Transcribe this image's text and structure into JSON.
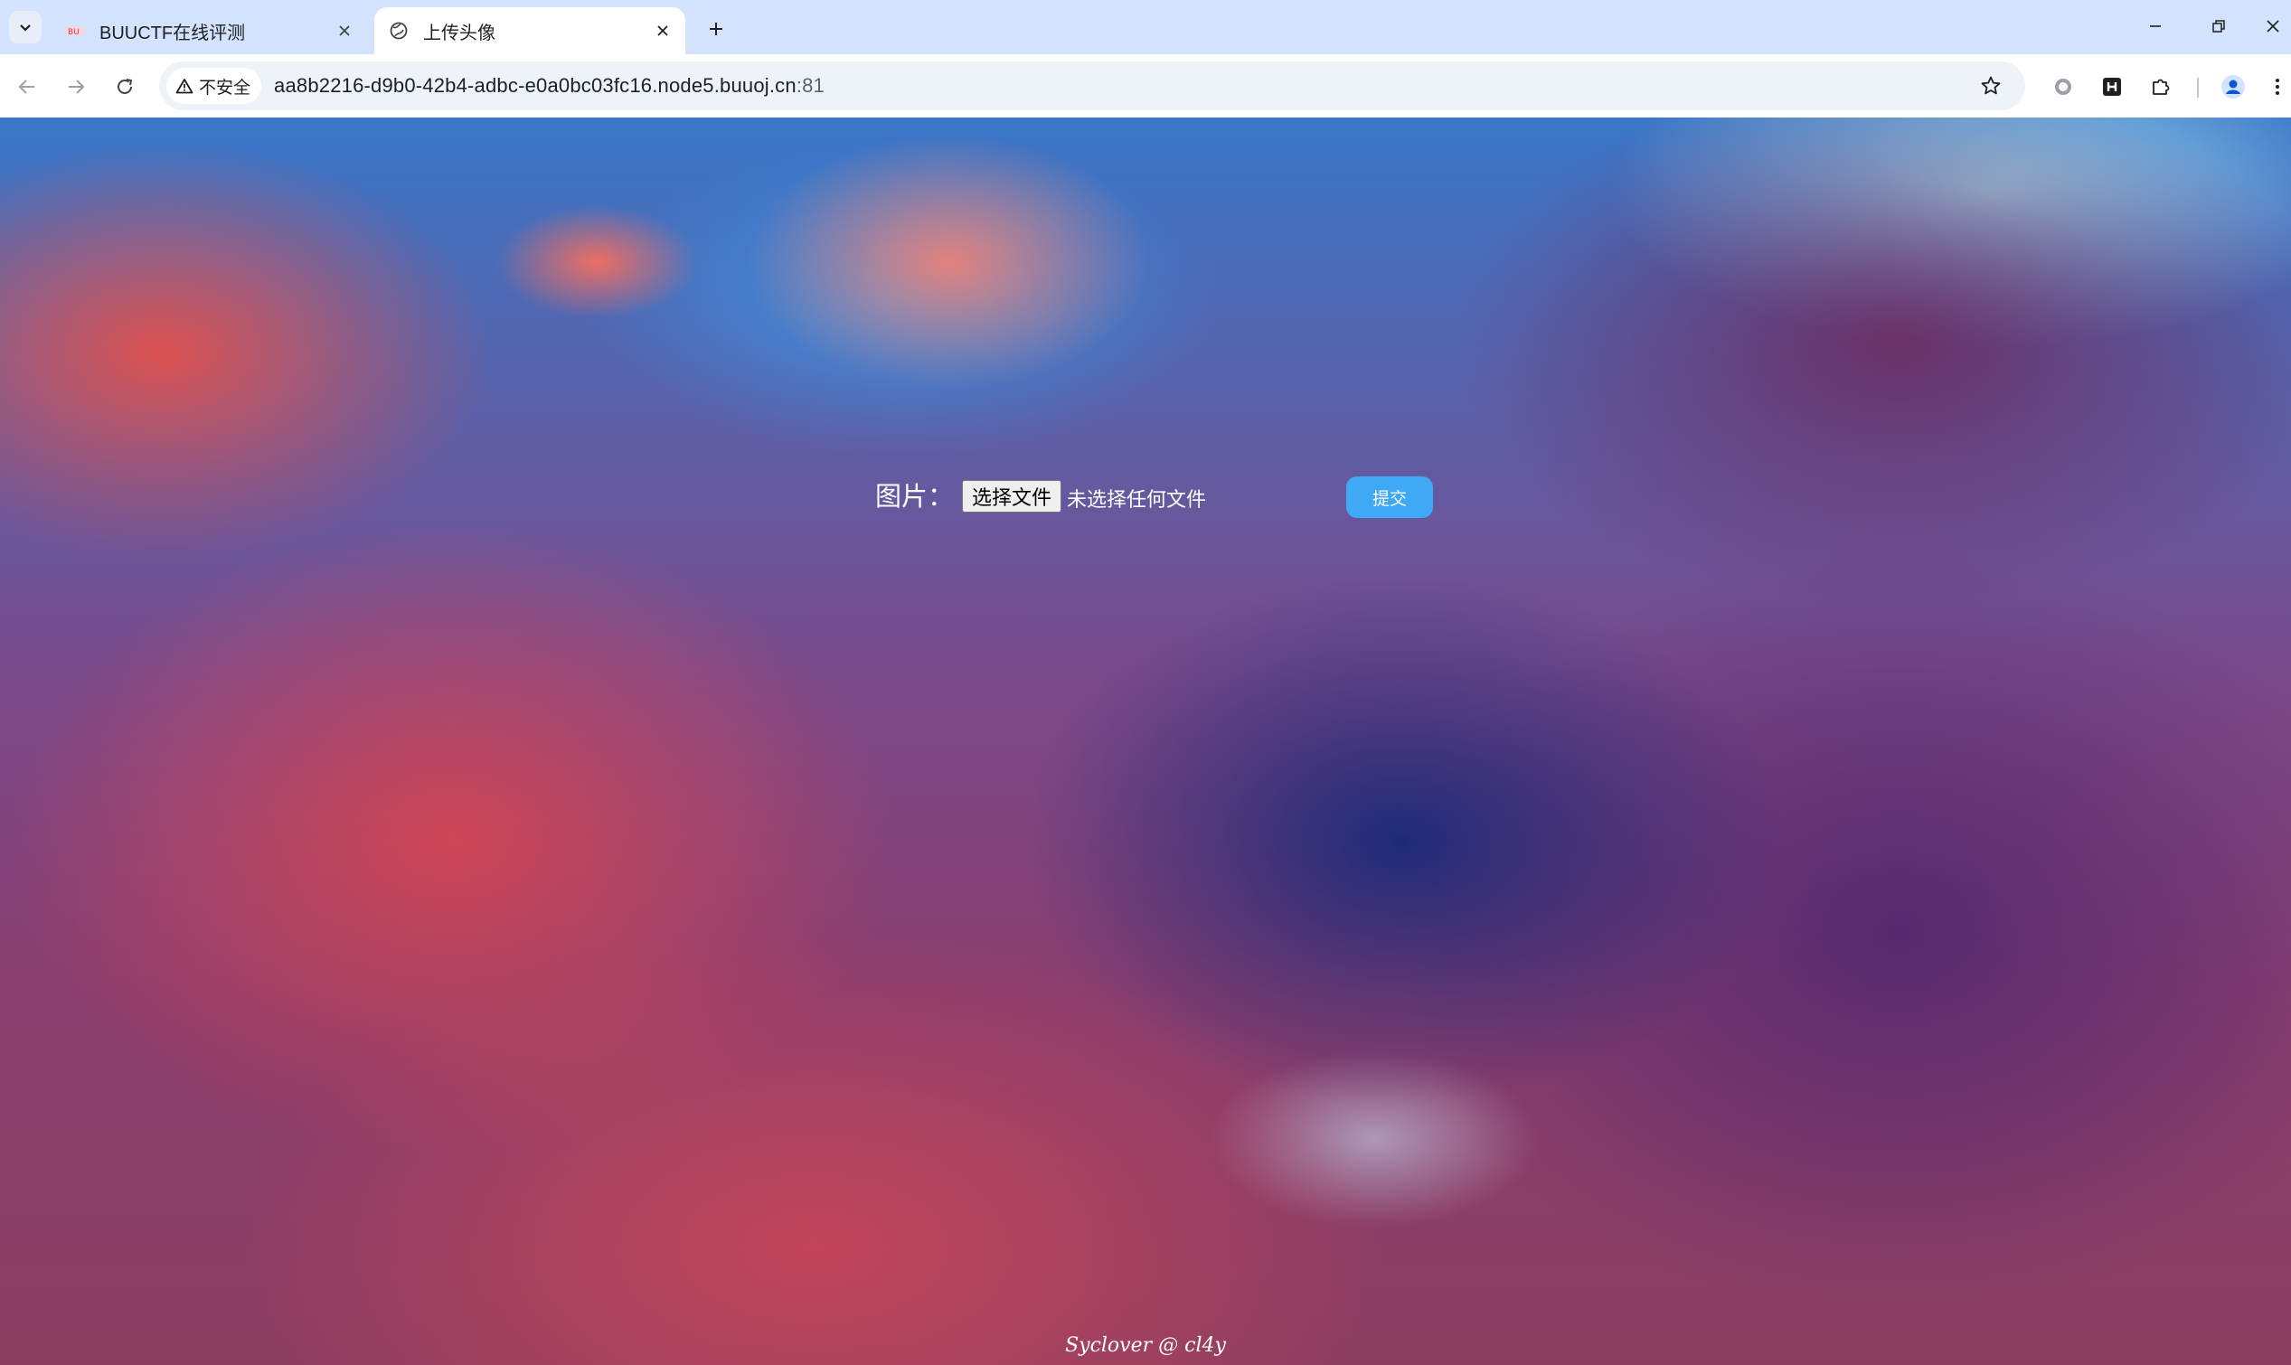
{
  "browser": {
    "tabs": [
      {
        "title": "BUUCTF在线评测",
        "icon": "buuctf-favicon",
        "active": false
      },
      {
        "title": "上传头像",
        "icon": "globe-icon",
        "active": true
      }
    ],
    "address_bar": {
      "security_label": "不安全",
      "url_host": "aa8b2216-d9b0-42b4-adbc-e0a0bc03fc16.node5.buuoj.cn",
      "url_port": ":81"
    }
  },
  "page": {
    "form": {
      "field_label": "图片：",
      "file_button_label": "选择文件",
      "file_status": "未选择任何文件",
      "submit_label": "提交"
    },
    "footer": "Syclover @ cl4y"
  },
  "colors": {
    "tabbar": "#d3e3fd",
    "submit_button": "#3fa9f5",
    "profile_accent": "#0b57d0"
  }
}
